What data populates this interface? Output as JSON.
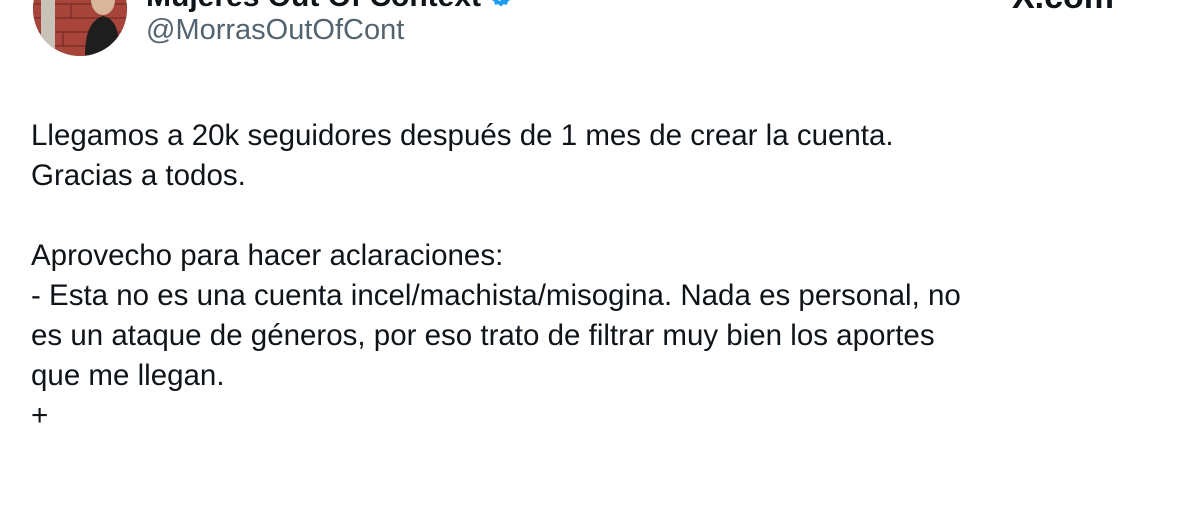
{
  "author": {
    "display_name": "Mujeres Out Of Context",
    "handle": "@MorrasOutOfCont",
    "verified": true
  },
  "source": {
    "label": "X.com"
  },
  "tweet": {
    "paragraphs": [
      "Llegamos a 20k seguidores después de 1 mes de crear la cuenta.\nGracias a todos.",
      "Aprovecho para hacer aclaraciones:\n- Esta no es una cuenta incel/machista/misogina. Nada es personal, no\nes un ataque de géneros, por eso trato de filtrar muy bien los aportes\nque me llegan.\n+"
    ]
  },
  "colors": {
    "text": "#0f1419",
    "secondary_text": "#536471",
    "verified_badge": "#1d9bf0"
  }
}
